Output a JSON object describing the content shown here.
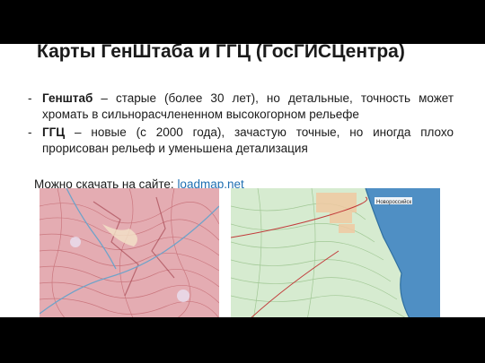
{
  "slide": {
    "title": "Карты ГенШтаба и ГГЦ (ГосГИСЦентра)",
    "bullets": [
      {
        "dash": "-",
        "term": "Генштаб",
        "text": " – старые (более 30 лет), но детальные, точность может хромать в сильнорасчлененном высокогорном рельефе"
      },
      {
        "dash": "-",
        "term": "ГГЦ",
        "text": " – новые (с 2000 года), зачастую точные, но иногда плохо прорисован рельеф и уменьшена детализация"
      }
    ],
    "download_prefix": "Можно скачать на сайте: ",
    "download_link": "loadmap.net"
  },
  "maps": {
    "left": {
      "kind": "topographic-map-genshtab",
      "base_color": "#e7b3b7",
      "contour_color": "#c46a72",
      "water_color": "#6fa3c9"
    },
    "right": {
      "kind": "topographic-map-ggc",
      "land_color": "#d6ebd0",
      "sea_color": "#4f8fc4",
      "town_label": "Новороссийск"
    }
  }
}
